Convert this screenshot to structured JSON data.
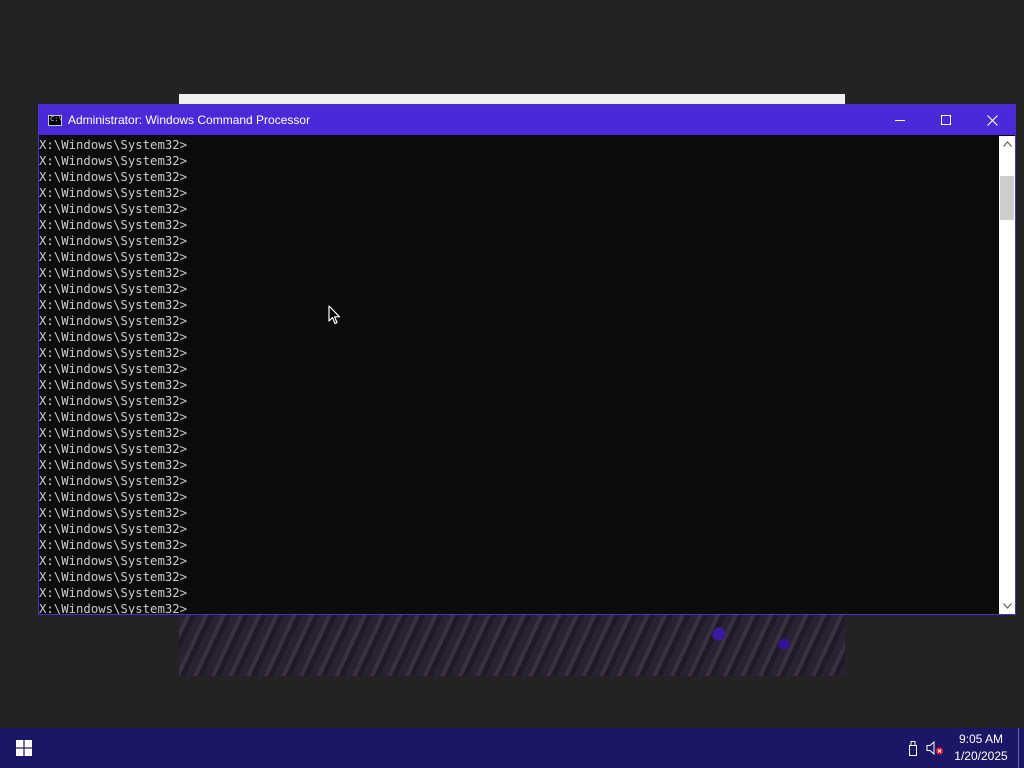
{
  "console": {
    "title": "Administrator: Windows Command Processor",
    "prompt_lines": [
      "X:\\Windows\\System32>",
      "X:\\Windows\\System32>",
      "X:\\Windows\\System32>",
      "X:\\Windows\\System32>",
      "X:\\Windows\\System32>",
      "X:\\Windows\\System32>",
      "X:\\Windows\\System32>",
      "X:\\Windows\\System32>",
      "X:\\Windows\\System32>",
      "X:\\Windows\\System32>",
      "X:\\Windows\\System32>",
      "X:\\Windows\\System32>",
      "X:\\Windows\\System32>",
      "X:\\Windows\\System32>",
      "X:\\Windows\\System32>",
      "X:\\Windows\\System32>",
      "X:\\Windows\\System32>",
      "X:\\Windows\\System32>",
      "X:\\Windows\\System32>",
      "X:\\Windows\\System32>",
      "X:\\Windows\\System32>",
      "X:\\Windows\\System32>",
      "X:\\Windows\\System32>",
      "X:\\Windows\\System32>",
      "X:\\Windows\\System32>",
      "X:\\Windows\\System32>",
      "X:\\Windows\\System32>",
      "X:\\Windows\\System32>",
      "X:\\Windows\\System32>",
      "X:\\Windows\\System32>"
    ],
    "controls": {
      "minimize_icon": "minimize-icon",
      "maximize_icon": "maximize-icon",
      "close_icon": "close-icon"
    }
  },
  "taskbar": {
    "start_icon": "windows-logo-icon",
    "tray": {
      "icons": [
        "usb-drive-icon",
        "speaker-muted-icon"
      ]
    },
    "clock": {
      "time": "9:05 AM",
      "date": "1/20/2025"
    }
  },
  "colors": {
    "titlebar": "#4a2ad8",
    "taskbar": "#1c1666",
    "console_bg": "#0c0c0c",
    "console_text": "#cccccc",
    "desktop": "#232323"
  }
}
